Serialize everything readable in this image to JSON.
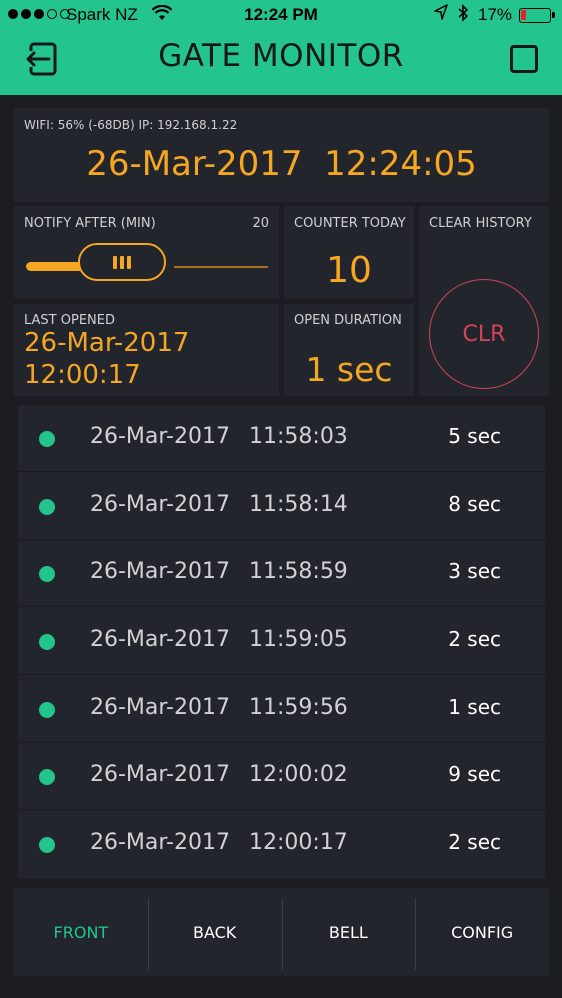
{
  "colors": {
    "accent": "#23c48e",
    "value": "#f5a623",
    "danger": "#d3435c"
  },
  "status_bar": {
    "carrier": "Spark NZ",
    "time": "12:24 PM",
    "battery": "17%"
  },
  "header": {
    "title": "GATE MONITOR",
    "left_icon": "exit-door-icon",
    "right_icon": "square-icon"
  },
  "info": {
    "network": "WIFI: 56% (-68DB) IP: 192.168.1.22",
    "clock": "26-Mar-2017  12:24:05"
  },
  "notify": {
    "label": "NOTIFY AFTER (MIN)",
    "value": "20",
    "slider_fraction": 0.3
  },
  "counter": {
    "label": "COUNTER TODAY",
    "value": "10"
  },
  "clear": {
    "label": "CLEAR HISTORY",
    "button": "CLR"
  },
  "last_opened": {
    "label": "LAST OPENED",
    "date": "26-Mar-2017",
    "time": "12:00:17"
  },
  "open_duration": {
    "label": "OPEN DURATION",
    "value": "1 sec"
  },
  "history": [
    {
      "date": "26-Mar-2017",
      "time": "11:58:03",
      "duration": "5 sec"
    },
    {
      "date": "26-Mar-2017",
      "time": "11:58:14",
      "duration": "8 sec"
    },
    {
      "date": "26-Mar-2017",
      "time": "11:58:59",
      "duration": "3 sec"
    },
    {
      "date": "26-Mar-2017",
      "time": "11:59:05",
      "duration": "2 sec"
    },
    {
      "date": "26-Mar-2017",
      "time": "11:59:56",
      "duration": "1 sec"
    },
    {
      "date": "26-Mar-2017",
      "time": "12:00:02",
      "duration": "9 sec"
    },
    {
      "date": "26-Mar-2017",
      "time": "12:00:17",
      "duration": "2 sec"
    }
  ],
  "tabs": [
    {
      "label": "FRONT",
      "active": true
    },
    {
      "label": "BACK",
      "active": false
    },
    {
      "label": "BELL",
      "active": false
    },
    {
      "label": "CONFIG",
      "active": false
    }
  ]
}
